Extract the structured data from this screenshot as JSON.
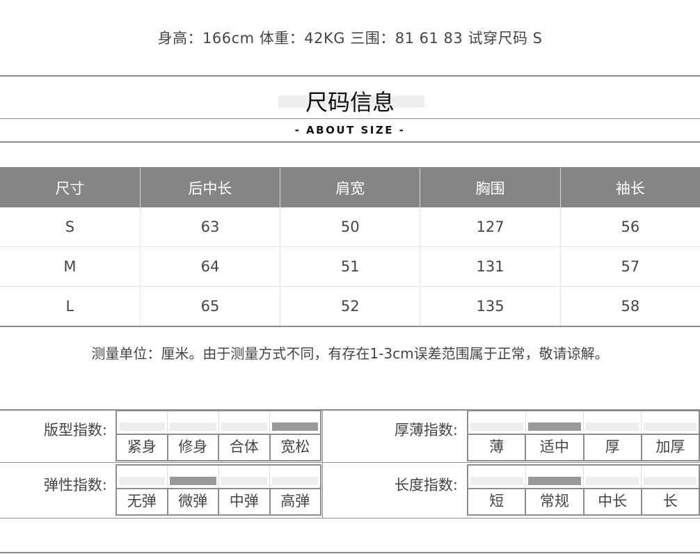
{
  "model_info": "身高：166cm 体重：42KG 三围：81 61 83 试穿尺码 S",
  "title": "尺码信息",
  "subtitle": "- ABOUT SIZE -",
  "size_table": {
    "headers": [
      "尺寸",
      "后中长",
      "肩宽",
      "胸围",
      "袖长"
    ],
    "rows": [
      [
        "S",
        "63",
        "50",
        "127",
        "56"
      ],
      [
        "M",
        "64",
        "51",
        "131",
        "57"
      ],
      [
        "L",
        "65",
        "52",
        "135",
        "58"
      ]
    ]
  },
  "note": "测量单位：厘米。由于测量方式不同，有存在1-3cm误差范围属于正常，敬请谅解。",
  "indices": {
    "fit": {
      "label": "版型指数:",
      "options": [
        "紧身",
        "修身",
        "合体",
        "宽松"
      ],
      "selected": 3
    },
    "thickness": {
      "label": "厚薄指数:",
      "options": [
        "薄",
        "适中",
        "厚",
        "加厚"
      ],
      "selected": 1
    },
    "elasticity": {
      "label": "弹性指数:",
      "options": [
        "无弹",
        "微弹",
        "中弹",
        "高弹"
      ],
      "selected": 1
    },
    "length": {
      "label": "长度指数:",
      "options": [
        "短",
        "常规",
        "中长",
        "长"
      ],
      "selected": 1
    }
  },
  "colors": {
    "header_bg": "#858585",
    "line": "#8c8c8c",
    "selected_bar": "#999999",
    "bar": "#eeeeee"
  }
}
